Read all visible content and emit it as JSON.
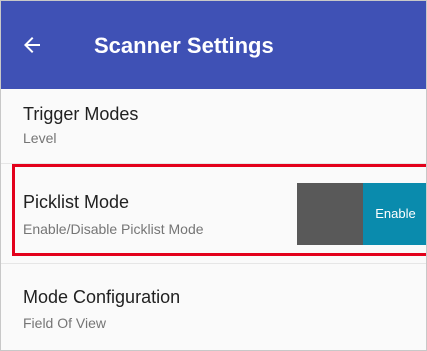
{
  "app_bar": {
    "title": "Scanner Settings",
    "back_icon": "arrow-back-icon",
    "color": "#3f51b5"
  },
  "settings": [
    {
      "title": "Trigger Modes",
      "summary": "Level"
    },
    {
      "title": "Picklist Mode",
      "summary": "Enable/Disable Picklist Mode",
      "toggle_label": "Enable",
      "toggle_state": "enabled",
      "highlighted": true
    },
    {
      "title": "Mode Configuration",
      "summary": "Field Of View"
    }
  ],
  "colors": {
    "highlight": "#e3001b",
    "toggle_on": "#0a8bad",
    "toggle_off": "#595959"
  }
}
